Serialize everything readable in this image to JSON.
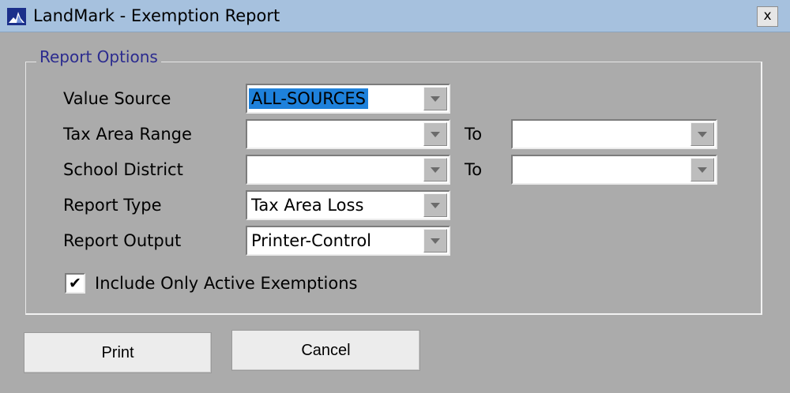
{
  "window": {
    "title": "LandMark - Exemption Report",
    "close_label": "x",
    "icon": "landmark-app-icon"
  },
  "report_options": {
    "legend": "Report Options",
    "value_source": {
      "label": "Value Source",
      "value": "ALL-SOURCES"
    },
    "tax_area_range": {
      "label": "Tax Area Range",
      "from_value": "",
      "to_label": "To",
      "to_value": ""
    },
    "school_district": {
      "label": "School District",
      "from_value": "",
      "to_label": "To",
      "to_value": ""
    },
    "report_type": {
      "label": "Report Type",
      "value": "Tax Area Loss"
    },
    "report_output": {
      "label": "Report Output",
      "value": "Printer-Control"
    },
    "include_active": {
      "label": "Include Only Active Exemptions",
      "checked": true,
      "check_mark": "✔"
    }
  },
  "buttons": {
    "print": "Print",
    "cancel": "Cancel"
  },
  "colors": {
    "titlebar": "#a6c1de",
    "background": "#ababab",
    "legend_text": "#2b2b8f",
    "selection": "#1e81db"
  }
}
